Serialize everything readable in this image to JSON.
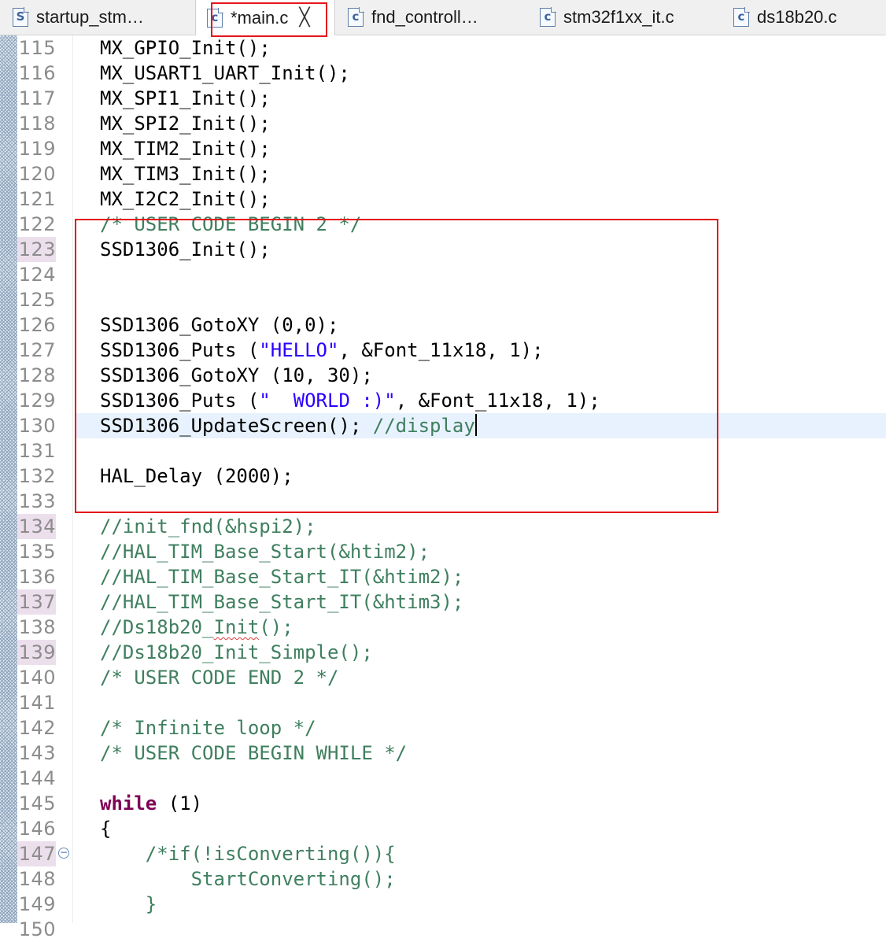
{
  "tabs": [
    {
      "name": "startup_stm…",
      "icon": "S",
      "icon_name": "asm-file-icon"
    },
    {
      "name": "*main.c",
      "icon": "c",
      "icon_name": "c-file-icon",
      "active": true
    },
    {
      "name": "fnd_controll…",
      "icon": "c",
      "icon_name": "c-file-icon"
    },
    {
      "name": "stm32f1xx_it.c",
      "icon": "c",
      "icon_name": "c-file-icon"
    },
    {
      "name": "ds18b20.c",
      "icon": "c",
      "icon_name": "c-file-icon"
    }
  ],
  "close_glyph": "╳",
  "fold_glyph": "−",
  "colors": {
    "keyword": "#7f0055",
    "string": "#2a00ff",
    "comment": "#3f7f5f",
    "highlight_box": "#e4151b",
    "current_line": "#e8f2fe"
  },
  "editor": {
    "current_line": 130,
    "lines": [
      {
        "n": "115",
        "parts": [
          {
            "t": "MX_GPIO_Init();"
          }
        ]
      },
      {
        "n": "116",
        "parts": [
          {
            "t": "MX_USART1_UART_Init();"
          }
        ]
      },
      {
        "n": "117",
        "parts": [
          {
            "t": "MX_SPI1_Init();"
          }
        ]
      },
      {
        "n": "118",
        "parts": [
          {
            "t": "MX_SPI2_Init();"
          }
        ]
      },
      {
        "n": "119",
        "parts": [
          {
            "t": "MX_TIM2_Init();"
          }
        ]
      },
      {
        "n": "120",
        "parts": [
          {
            "t": "MX_TIM3_Init();"
          }
        ]
      },
      {
        "n": "121",
        "parts": [
          {
            "t": "MX_I2C2_Init();"
          }
        ]
      },
      {
        "n": "122",
        "parts": [
          {
            "t": "/* USER CODE BEGIN 2 */",
            "k": "cmt"
          }
        ]
      },
      {
        "n": "123",
        "mark": true,
        "parts": [
          {
            "t": "SSD1306_Init();"
          }
        ]
      },
      {
        "n": "124",
        "parts": []
      },
      {
        "n": "125",
        "parts": []
      },
      {
        "n": "126",
        "parts": [
          {
            "t": "SSD1306_GotoXY (0,0);"
          }
        ]
      },
      {
        "n": "127",
        "parts": [
          {
            "t": "SSD1306_Puts ("
          },
          {
            "t": "\"HELLO\"",
            "k": "str"
          },
          {
            "t": ", &Font_11x18, 1);"
          }
        ]
      },
      {
        "n": "128",
        "parts": [
          {
            "t": "SSD1306_GotoXY (10, 30);"
          }
        ]
      },
      {
        "n": "129",
        "parts": [
          {
            "t": "SSD1306_Puts ("
          },
          {
            "t": "\"  WORLD :)\"",
            "k": "str"
          },
          {
            "t": ", &Font_11x18, 1);"
          }
        ]
      },
      {
        "n": "130",
        "current": true,
        "caret": true,
        "parts": [
          {
            "t": "SSD1306_UpdateScreen(); "
          },
          {
            "t": "//display",
            "k": "cmt"
          }
        ]
      },
      {
        "n": "131",
        "parts": []
      },
      {
        "n": "132",
        "parts": [
          {
            "t": "HAL_Delay (2000);"
          }
        ]
      },
      {
        "n": "133",
        "parts": []
      },
      {
        "n": "134",
        "mark": true,
        "parts": [
          {
            "t": "//init_fnd(&hspi2);",
            "k": "cmt"
          }
        ]
      },
      {
        "n": "135",
        "parts": [
          {
            "t": "//HAL_TIM_Base_Start(&htim2);",
            "k": "cmt"
          }
        ]
      },
      {
        "n": "136",
        "parts": [
          {
            "t": "//HAL_TIM_Base_Start_IT(&htim2);",
            "k": "cmt"
          }
        ]
      },
      {
        "n": "137",
        "mark": true,
        "parts": [
          {
            "t": "//HAL_TIM_Base_Start_IT(&htim3);",
            "k": "cmt"
          }
        ]
      },
      {
        "n": "138",
        "parts": [
          {
            "t": "//Ds18b20_",
            "k": "cmt"
          },
          {
            "t": "Init",
            "k": "cmt",
            "sq": true
          },
          {
            "t": "();",
            "k": "cmt"
          }
        ]
      },
      {
        "n": "139",
        "mark": true,
        "parts": [
          {
            "t": "//Ds18b20_Init_Simple();",
            "k": "cmt"
          }
        ]
      },
      {
        "n": "140",
        "parts": [
          {
            "t": "/* USER CODE END 2 */",
            "k": "cmt"
          }
        ]
      },
      {
        "n": "141",
        "parts": []
      },
      {
        "n": "142",
        "parts": [
          {
            "t": "/* Infinite loop */",
            "k": "cmt"
          }
        ]
      },
      {
        "n": "143",
        "parts": [
          {
            "t": "/* USER CODE BEGIN WHILE */",
            "k": "cmt"
          }
        ]
      },
      {
        "n": "144",
        "parts": []
      },
      {
        "n": "145",
        "parts": [
          {
            "t": "while",
            "k": "kw"
          },
          {
            "t": " (1)"
          }
        ]
      },
      {
        "n": "146",
        "parts": [
          {
            "t": "{"
          }
        ]
      },
      {
        "n": "147",
        "mark": true,
        "fold": true,
        "parts": [
          {
            "t": "    /*if(!isConverting()){",
            "k": "cmt"
          }
        ]
      },
      {
        "n": "148",
        "parts": [
          {
            "t": "        StartConverting();",
            "k": "cmt"
          }
        ]
      },
      {
        "n": "149",
        "parts": [
          {
            "t": "    }",
            "k": "cmt"
          }
        ]
      },
      {
        "n": "150",
        "parts": []
      }
    ]
  }
}
